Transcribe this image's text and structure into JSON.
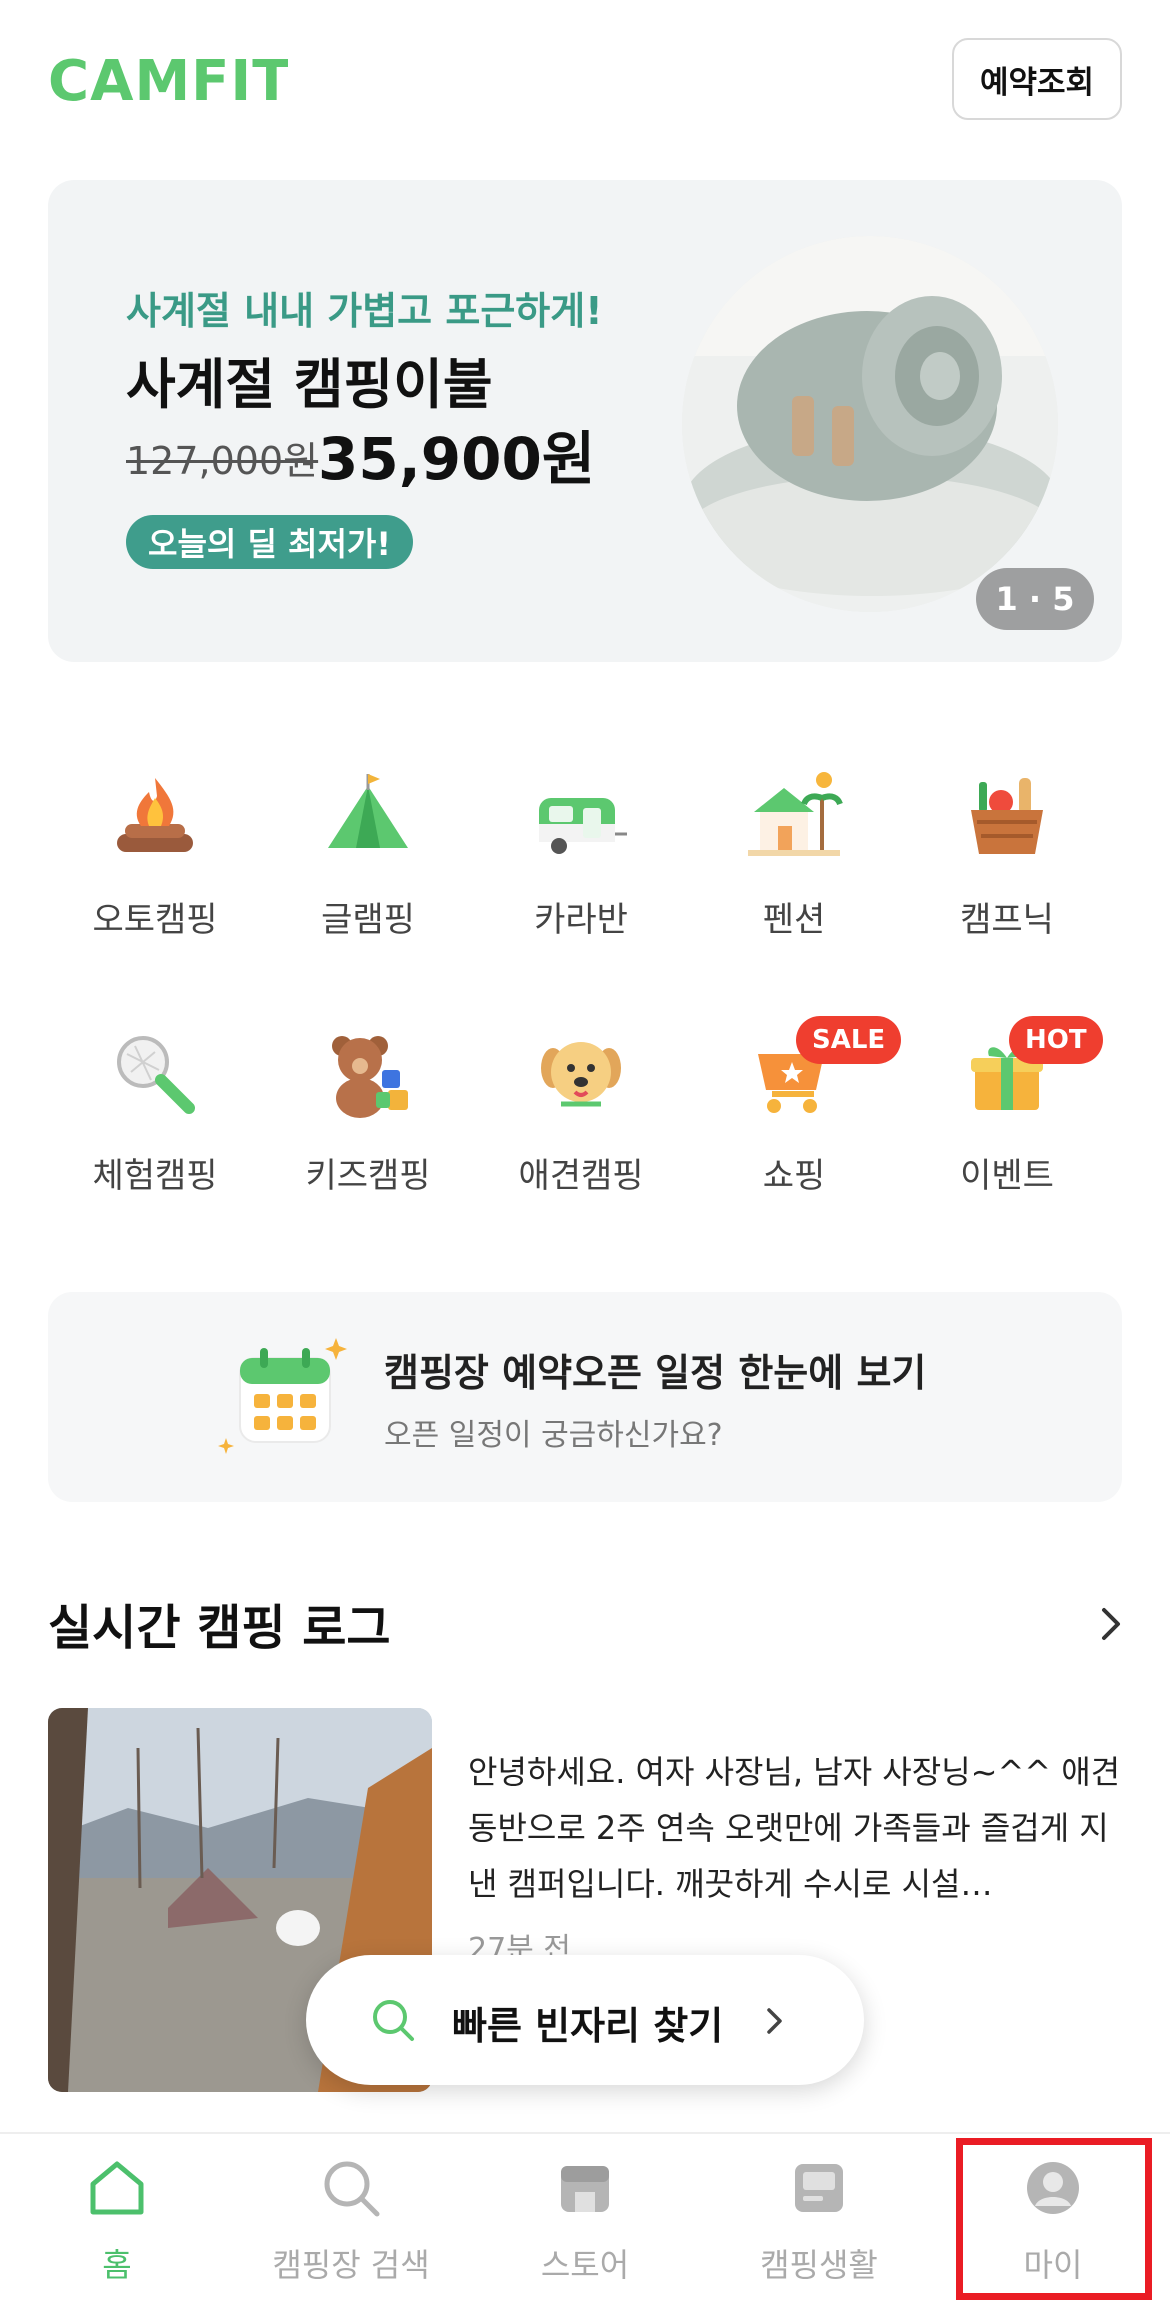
{
  "header": {
    "logo_text": "CAMFIT",
    "reserve_button": "예약조회",
    "brand_color": "#5cc86f"
  },
  "banner": {
    "subtitle": "사계절 내내 가볍고 포근하게!",
    "title": "사계절 캠핑이불",
    "price_original": "127,000원",
    "price_sale": "35,900원",
    "badge": "오늘의 딜 최저가!",
    "pager": "1 · 5"
  },
  "categories": [
    {
      "label": "오토캠핑",
      "icon": "campfire-icon"
    },
    {
      "label": "글램핑",
      "icon": "tent-icon"
    },
    {
      "label": "카라반",
      "icon": "caravan-icon"
    },
    {
      "label": "펜션",
      "icon": "pension-icon"
    },
    {
      "label": "캠프닉",
      "icon": "picnic-basket-icon"
    },
    {
      "label": "체험캠핑",
      "icon": "bug-net-icon"
    },
    {
      "label": "키즈캠핑",
      "icon": "teddy-bear-icon"
    },
    {
      "label": "애견캠핑",
      "icon": "dog-icon"
    },
    {
      "label": "쇼핑",
      "icon": "shopping-cart-icon",
      "tag": "SALE"
    },
    {
      "label": "이벤트",
      "icon": "gift-icon",
      "tag": "HOT"
    }
  ],
  "schedule": {
    "title": "캠핑장 예약오픈 일정 한눈에 보기",
    "subtitle": "오픈 일정이 궁금하신가요?",
    "icon": "calendar-icon"
  },
  "live_log": {
    "title": "실시간 캠핑 로그",
    "post_text": "안녕하세요. 여자 사장님, 남자 사장닝~^^ 애견동반으로 2주 연속 오랫만에 가족들과 즐겁게 지낸 캠퍼입니다. 깨끗하게 수시로 시설…",
    "post_time": "27분 전"
  },
  "quick_search": {
    "label": "빠른 빈자리 찾기"
  },
  "bottom_nav": [
    {
      "label": "홈",
      "icon": "home-icon",
      "active": true
    },
    {
      "label": "캠핑장 검색",
      "icon": "search-icon",
      "active": false
    },
    {
      "label": "스토어",
      "icon": "store-icon",
      "active": false
    },
    {
      "label": "캠핑생활",
      "icon": "camping-life-icon",
      "active": false
    },
    {
      "label": "마이",
      "icon": "profile-icon",
      "active": false
    }
  ],
  "colors": {
    "accent": "#5cc86f",
    "banner_green": "#3a9a86",
    "highlight": "#ea1c24"
  }
}
